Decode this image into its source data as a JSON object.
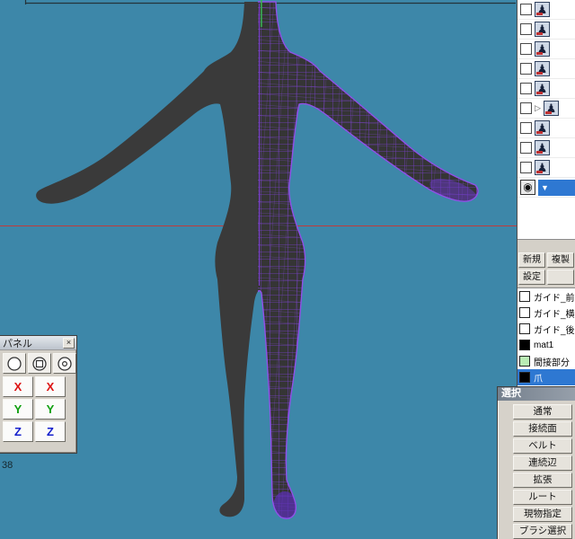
{
  "colors": {
    "selection_blue": "#2e78d2",
    "panel_gray": "#d4d0c8",
    "viewport_bg": "#3d87a9",
    "model_fill": "#3a3a3a",
    "wire_purple": "#7a3fd0",
    "wire_edge": "#9050e8",
    "axis_red": "#c23b3b",
    "axis_green": "#2fbf3f"
  },
  "glyphs": {
    "object_icon": "♟",
    "eye_icon": "◉",
    "caret_down": "▼",
    "expander": "▷",
    "close": "×"
  },
  "viewport": {
    "coord_label": "38"
  },
  "object_panel": {
    "row_count": 10,
    "selected_row_index": 9
  },
  "material_panel": {
    "buttons": {
      "new": "新規",
      "duplicate": "複製",
      "settings": "設定",
      "extra": ""
    },
    "rows": [
      {
        "label": "ガイド_前",
        "swatch": "#ffffff"
      },
      {
        "label": "ガイド_横",
        "swatch": "#ffffff"
      },
      {
        "label": "ガイド_後",
        "swatch": "#ffffff"
      },
      {
        "label": "mat1",
        "swatch": "#000000"
      },
      {
        "label": "間接部分",
        "swatch": "#b9ecb4"
      },
      {
        "label": "爪",
        "swatch": "#000000",
        "selected": true
      }
    ]
  },
  "selection_panel": {
    "title": "選択",
    "buttons": [
      "通常",
      "接続面",
      "ベルト",
      "連続辺",
      "拡張",
      "ルート",
      "現物指定",
      "ブラシ選択"
    ]
  },
  "control_panel": {
    "title": "パネル",
    "axis_buttons": [
      {
        "label": "X",
        "color": "#dd1111"
      },
      {
        "label": "X",
        "color": "#dd1111"
      },
      {
        "label": "Y",
        "color": "#0f9f0f"
      },
      {
        "label": "Y",
        "color": "#0f9f0f"
      },
      {
        "label": "Z",
        "color": "#1520cc"
      },
      {
        "label": "Z",
        "color": "#1520cc"
      }
    ]
  }
}
